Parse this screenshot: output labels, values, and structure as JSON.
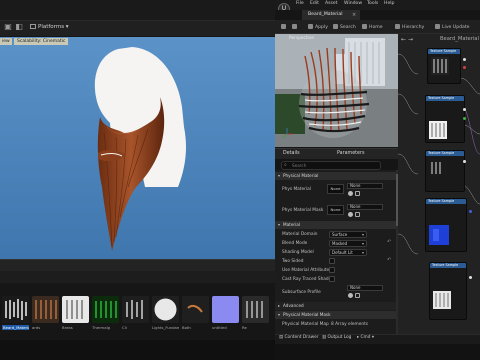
{
  "left_editor": {
    "platforms_label": "Platforms",
    "viewport_chip_view": "iew",
    "viewport_chip_scal": "Scalability: Cinematic",
    "thumbnails": [
      {
        "label": "Beard_Material",
        "selected": true
      },
      {
        "label": "ards"
      },
      {
        "label": "Breas"
      },
      {
        "label": "Thermalg"
      },
      {
        "label": "Cli"
      },
      {
        "label": "Lights_Fundame"
      },
      {
        "label": "Both"
      },
      {
        "label": "untitled"
      },
      {
        "label": "Re"
      }
    ]
  },
  "material_editor": {
    "menu": [
      "File",
      "Edit",
      "Asset",
      "Window",
      "Tools",
      "Help"
    ],
    "tab_title": "Beard_Material",
    "toolbar": {
      "save": "Save",
      "apply": "Apply",
      "search": "Search",
      "home": "Home",
      "hierarchy": "Hierarchy",
      "live_update": "Live Update"
    },
    "preview_label": "Perspective",
    "details": {
      "tab_details": "Details",
      "tab_parameters": "Parameters",
      "search_placeholder": "Search",
      "sections": {
        "physical_material": "Physical Material",
        "material": "Material",
        "advanced": "Advanced",
        "physical_material_mask": "Physical Material Mask"
      },
      "properties": {
        "phys_material": {
          "label": "Phys Material",
          "thumb": "None",
          "value": "None"
        },
        "phys_material_mask": {
          "label": "Phys Material Mask",
          "thumb": "None",
          "value": "None"
        },
        "material_domain": {
          "label": "Material Domain",
          "value": "Surface"
        },
        "blend_mode": {
          "label": "Blend Mode",
          "value": "Masked"
        },
        "shading_model": {
          "label": "Shading Model",
          "value": "Default Lit"
        },
        "two_sided": {
          "label": "Two Sided"
        },
        "use_material_attributes": {
          "label": "Use Material Attributes"
        },
        "cast_ray_traced_shadows": {
          "label": "Cast Ray Traced Shado"
        },
        "subsurface_profile": {
          "label": "Subsurface Profile",
          "value": "None"
        },
        "physical_material_map": {
          "label": "Physical Material Map",
          "value": "8 Array elements"
        }
      }
    },
    "status": {
      "content_drawer": "Content Drawer",
      "output_log": "Output Log",
      "cmd": "Cmd"
    },
    "graph": {
      "title": "Beard_Material",
      "nodes": [
        "Texture Sample",
        "Texture Sample",
        "Texture Sample",
        "Texture Sample",
        "Texture Sample"
      ]
    }
  },
  "colors": {
    "viewport_sky": "#4f88bf",
    "node_header_blue": "#2b5c94",
    "selected_blue": "#1f5aa6",
    "beard_brown": "#8a3f1c"
  }
}
